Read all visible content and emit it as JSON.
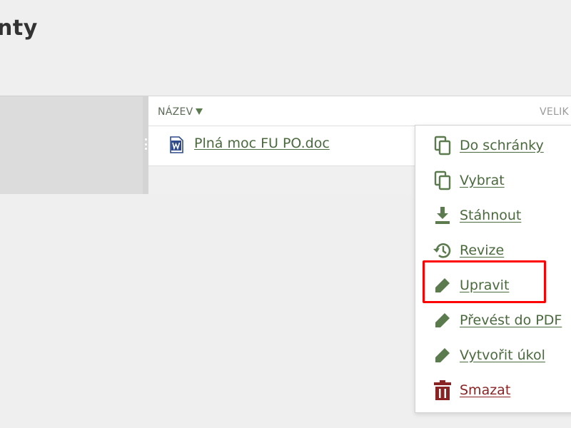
{
  "page": {
    "title": "nty"
  },
  "table": {
    "columns": {
      "name": "NÁZEV",
      "size": "VELIK"
    },
    "rows": [
      {
        "name": "Plná moc FU PO.doc",
        "icon": "word-document-icon"
      }
    ]
  },
  "context_menu": {
    "items": [
      {
        "label": "Do schránky",
        "icon": "clipboard-copy-icon"
      },
      {
        "label": "Vybrat",
        "icon": "select-copy-icon"
      },
      {
        "label": "Stáhnout",
        "icon": "download-icon"
      },
      {
        "label": "Revize",
        "icon": "history-icon"
      },
      {
        "label": "Upravit",
        "icon": "pencil-icon"
      },
      {
        "label": "Převést do PDF",
        "icon": "pencil-icon"
      },
      {
        "label": "Vytvořit úkol",
        "icon": "pencil-icon"
      },
      {
        "label": "Smazat",
        "icon": "trash-icon"
      }
    ]
  },
  "colors": {
    "accent": "#4a6a3e",
    "icon": "#5b7a4e",
    "danger": "#8a2424",
    "highlight": "#ff0000"
  }
}
